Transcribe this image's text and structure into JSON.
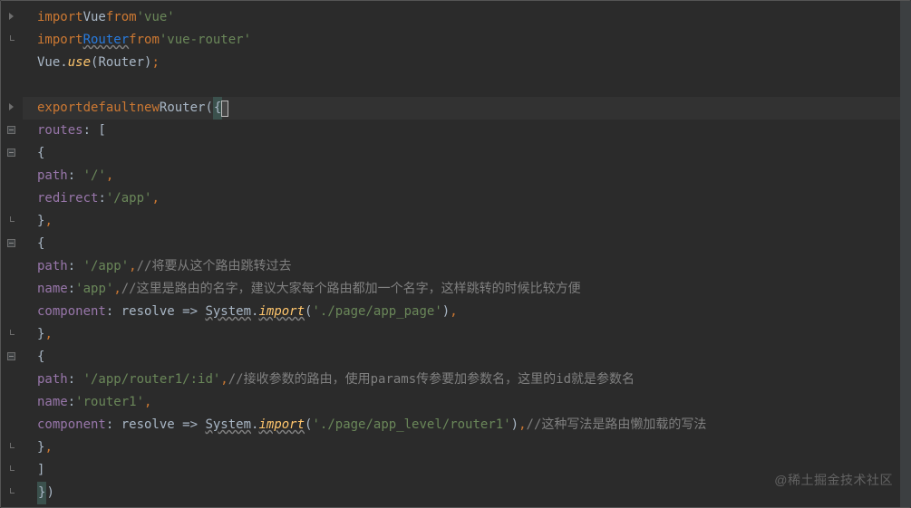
{
  "watermark": "@稀土掘金技术社区",
  "code": {
    "l1": {
      "import": "import",
      "vue": "Vue",
      "from": "from",
      "str": "'vue'"
    },
    "l2": {
      "import": "import",
      "router": "Router",
      "from": "from",
      "str": "'vue-router'"
    },
    "l3": {
      "vue": "Vue.",
      "use": "use",
      "open": "(",
      "arg": "Router",
      "close": ")",
      "semi": ";"
    },
    "l5": {
      "export": "export",
      "default": "default",
      "new": "new",
      "router": "Router",
      "open": "(",
      "brace": "{"
    },
    "l6": {
      "routes": "routes",
      "colon": ": [",
      "open": ""
    },
    "l7": {
      "brace": "{"
    },
    "l8": {
      "path": "path",
      "colon": ": ",
      "str": "'/'",
      "comma": ","
    },
    "l9": {
      "redirect": "redirect",
      "colon": ":",
      "str": "'/app'",
      "comma": ","
    },
    "l10": {
      "brace": "}",
      "comma": ","
    },
    "l11": {
      "brace": "{"
    },
    "l12": {
      "path": "path",
      "colon": ": ",
      "str": "'/app'",
      "comma": ",",
      "comment": "//将要从这个路由跳转过去"
    },
    "l13": {
      "name": "name",
      "colon": ":",
      "str": "'app'",
      "comma": ",",
      "comment": "//这里是路由的名字，建议大家每个路由都加一个名字，这样跳转的时候比较方便"
    },
    "l14": {
      "component": "component",
      "colon": ": ",
      "resolve": "resolve",
      "arrow": " => ",
      "system": "System",
      "dot": ".",
      "import": "import",
      "open": "(",
      "str": "'./page/app_page'",
      "close": ")",
      "comma": ","
    },
    "l15": {
      "brace": "}",
      "comma": ","
    },
    "l16": {
      "brace": "{"
    },
    "l17": {
      "path": "path",
      "colon": ": ",
      "str": "'/app/router1/:id'",
      "comma": ",",
      "comment": "//接收参数的路由，使用params传参要加参数名，这里的id就是参数名"
    },
    "l18": {
      "name": "name",
      "colon": ":",
      "str": "'router1'",
      "comma": ","
    },
    "l19": {
      "component": "component",
      "colon": ": ",
      "resolve": "resolve",
      "arrow": " => ",
      "system": "System",
      "dot": ".",
      "import": "import",
      "open": "(",
      "str": "'./page/app_level/router1'",
      "close": ")",
      "comma": ",",
      "comment": "//这种写法是路由懒加载的写法"
    },
    "l20": {
      "brace": "}",
      "comma": ","
    },
    "l21": {
      "bracket": "]"
    },
    "l22": {
      "brace": "}",
      "paren": ")"
    }
  }
}
